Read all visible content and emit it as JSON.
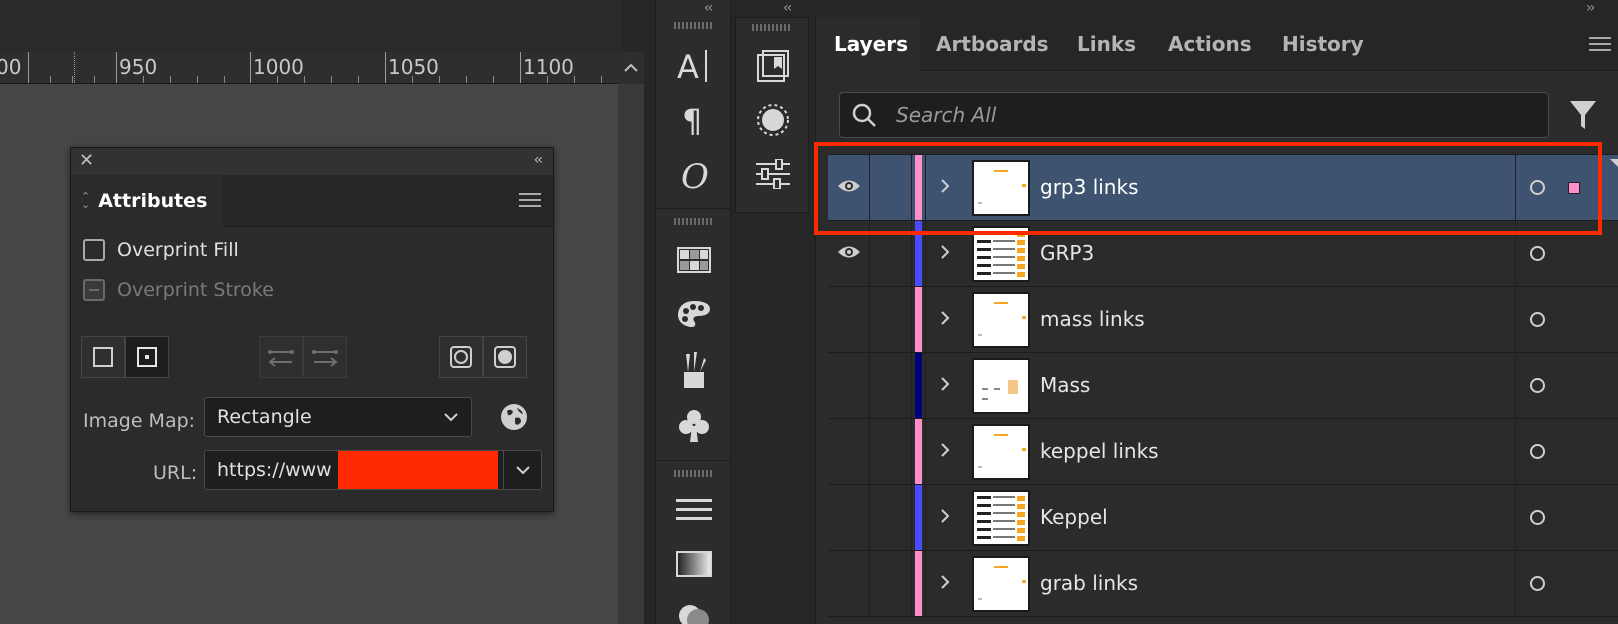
{
  "ruler": {
    "labels": [
      "00",
      "950",
      "1000",
      "1050",
      "1100"
    ]
  },
  "attributes_panel": {
    "title": "Attributes",
    "overprint_fill_label": "Overprint Fill",
    "overprint_fill_checked": false,
    "overprint_stroke_label": "Overprint Stroke",
    "overprint_stroke_enabled": false,
    "image_map_label": "Image Map:",
    "image_map_value": "Rectangle",
    "url_label": "URL:",
    "url_value": "https://www"
  },
  "layers_panel": {
    "tabs": [
      {
        "label": "Layers",
        "active": true
      },
      {
        "label": "Artboards",
        "active": false
      },
      {
        "label": "Links",
        "active": false
      },
      {
        "label": "Actions",
        "active": false
      },
      {
        "label": "History",
        "active": false
      }
    ],
    "search_placeholder": "Search All",
    "layers": [
      {
        "name": "grp3 links",
        "visible": true,
        "color": "#ff8fc8",
        "selected": true,
        "thumb": "links"
      },
      {
        "name": "GRP3",
        "visible": true,
        "color": "#4a4aff",
        "selected": false,
        "thumb": "table"
      },
      {
        "name": "mass links",
        "visible": false,
        "color": "#ff8fc8",
        "selected": false,
        "thumb": "links"
      },
      {
        "name": "Mass",
        "visible": false,
        "color": "#00007a",
        "selected": false,
        "thumb": "sparse"
      },
      {
        "name": "keppel links",
        "visible": false,
        "color": "#ff8fc8",
        "selected": false,
        "thumb": "links"
      },
      {
        "name": "Keppel",
        "visible": false,
        "color": "#4a4aff",
        "selected": false,
        "thumb": "table"
      },
      {
        "name": "grab links",
        "visible": false,
        "color": "#ff8fc8",
        "selected": false,
        "thumb": "links"
      }
    ]
  },
  "colors": {
    "selection_row": "#3d5370",
    "highlight": "#ff2a00"
  }
}
